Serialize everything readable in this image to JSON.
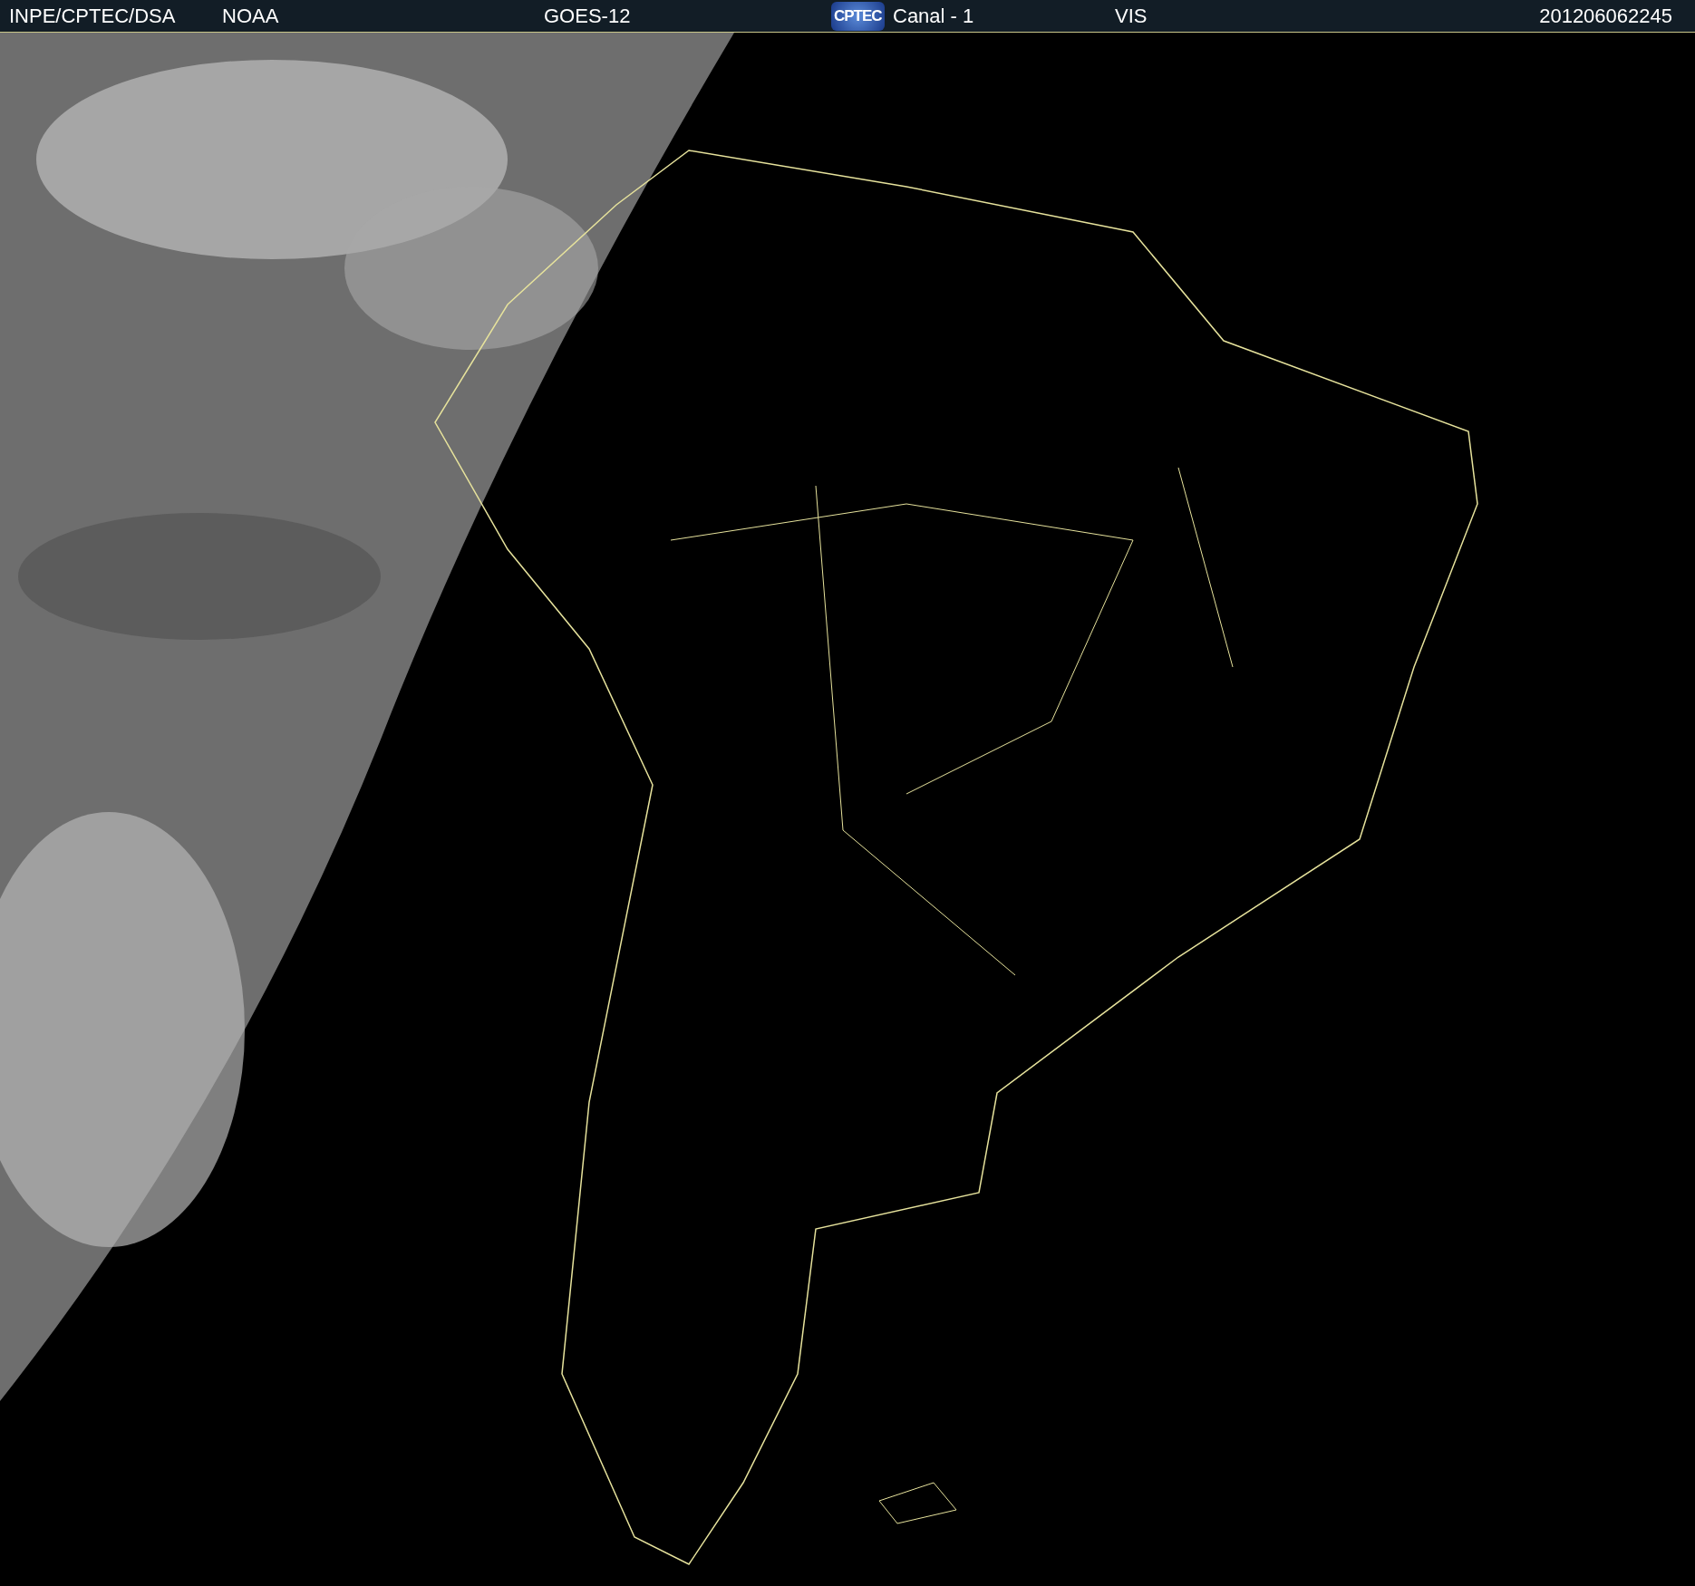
{
  "header": {
    "items": [
      {
        "kind": "text",
        "text": "INPE/CPTEC/DSA"
      },
      {
        "kind": "text",
        "text": "NOAA"
      },
      {
        "kind": "text",
        "text": "GOES-12"
      },
      {
        "kind": "logo",
        "text": "CPTEC"
      },
      {
        "kind": "text",
        "text": "Canal - 1"
      },
      {
        "kind": "text",
        "text": "VIS"
      },
      {
        "kind": "text",
        "text": "201206062245"
      }
    ]
  }
}
